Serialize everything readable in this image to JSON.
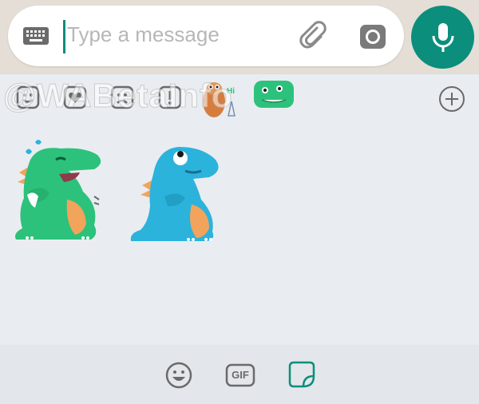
{
  "compose": {
    "placeholder": "Type a message",
    "icons": [
      "keyboard-icon",
      "attach-icon",
      "camera-icon",
      "mic-icon"
    ]
  },
  "tray": {
    "categories": [
      "smiley-icon",
      "heart-icon",
      "sad-face-icon",
      "exclaim-icon",
      "sticker-pack-cuppy",
      "sticker-pack-dino"
    ],
    "add_label": "+",
    "stickers": [
      "dino-crying-sticker",
      "dino-blue-sticker"
    ]
  },
  "watermark": "@WABetaInfo",
  "bottom": {
    "gif_label": "GIF",
    "icons": [
      "emoji-icon",
      "gif-icon",
      "sticker-icon"
    ]
  },
  "colors": {
    "accent": "#0b8e7c",
    "green_dino": "#2cc27b",
    "blue_dino": "#2bb3dc",
    "tray_bg": "#e9edf1"
  }
}
